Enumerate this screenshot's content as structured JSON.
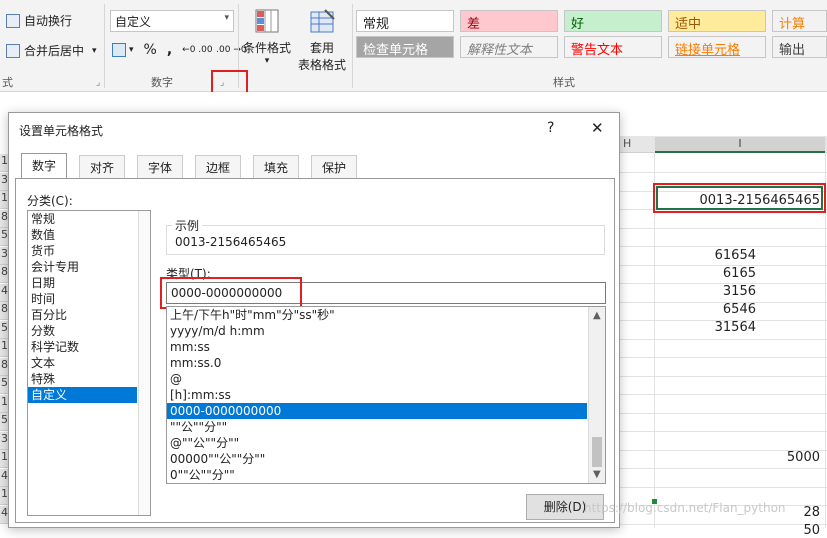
{
  "ribbon": {
    "wrap_text": "自动换行",
    "merge_center": "合并后居中",
    "number_format_combo": "自定义",
    "percent": "%",
    "comma": ",",
    "increase_decimal": "←0 .00",
    "decrease_decimal": ".00 →0",
    "conditional_format": "条件格式",
    "format_table_line1": "套用",
    "format_table_line2": "表格格式",
    "group_left_partial": "式",
    "group_number": "数字",
    "group_styles": "样式",
    "dropdown_glyph": "▾",
    "styles": [
      {
        "label": "常规",
        "bg": "#ffffff",
        "color": "#222222"
      },
      {
        "label": "差",
        "bg": "#ffc7ce",
        "color": "#9c0006"
      },
      {
        "label": "好",
        "bg": "#c6efce",
        "color": "#006100"
      },
      {
        "label": "适中",
        "bg": "#ffeb9c",
        "color": "#9c5700"
      },
      {
        "label": "计算",
        "bg": "#f2f2f2",
        "color": "#fa7d00"
      },
      {
        "label": "检查单元格",
        "bg": "#a5a5a5",
        "color": "#ffffff"
      },
      {
        "label": "解释性文本",
        "bg": "#f3f3f3",
        "color": "#7f7f7f"
      },
      {
        "label": "警告文本",
        "bg": "#f3f3f3",
        "color": "#ff0000"
      },
      {
        "label": "链接单元格",
        "bg": "#f3f3f3",
        "color": "#fa7d00"
      },
      {
        "label": "输出",
        "bg": "#f2f2f2",
        "color": "#3f3f3f"
      }
    ]
  },
  "sheet": {
    "col_h": "H",
    "col_i": "I",
    "row_fragments": [
      "1",
      "3",
      "1",
      "8",
      "5",
      "3",
      "8",
      "4",
      "8",
      "5",
      "1",
      "8",
      "5",
      "1",
      "5",
      "3",
      "1",
      "4",
      "1",
      "4"
    ],
    "values": {
      "highlighted": "0013-2156465465",
      "v1": "61654",
      "v2": "6165",
      "v3": "3156",
      "v4": "6546",
      "v5": "31564",
      "v6": "5000",
      "v7": "28",
      "v8": "50"
    }
  },
  "dialog": {
    "title": "设置单元格格式",
    "help": "?",
    "close": "✕",
    "tabs": [
      "数字",
      "对齐",
      "字体",
      "边框",
      "填充",
      "保护"
    ],
    "category_label": "分类(C):",
    "categories": [
      "常规",
      "数值",
      "货币",
      "会计专用",
      "日期",
      "时间",
      "百分比",
      "分数",
      "科学记数",
      "文本",
      "特殊",
      "自定义"
    ],
    "selected_category": 11,
    "sample_label": "示例",
    "sample_value": "0013-2156465465",
    "type_label": "类型(T):",
    "type_value": "0000-0000000000",
    "formats": [
      "上午/下午h\"时\"mm\"分\"ss\"秒\"",
      "yyyy/m/d h:mm",
      "mm:ss",
      "mm:ss.0",
      "@",
      "[h]:mm:ss",
      "0000-0000000000",
      "\"\"公\"\"分\"\"",
      "@\"\"公\"\"分\"\"",
      "00000\"\"公\"\"分\"\"",
      "0\"\"公\"\"分\"\""
    ],
    "selected_format": 6,
    "delete_button": "删除(D)",
    "scroll_up": "▲",
    "scroll_down": "▼"
  },
  "watermark": "https://blog.csdn.net/Flan_python",
  "accent": "#0078d7",
  "highlight_red": "#e02020"
}
